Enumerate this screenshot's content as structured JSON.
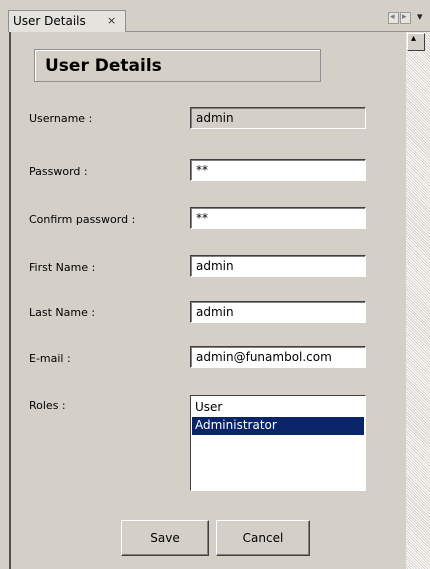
{
  "tab": {
    "title": "User Details",
    "close_glyph": "×"
  },
  "nav": {
    "prev_icon": "◂",
    "next_icon": "▸",
    "menu_icon": "▾"
  },
  "scrollbar": {
    "up_icon": "▴"
  },
  "form": {
    "title": "User Details",
    "fields": [
      {
        "label": "Username :",
        "value": "admin",
        "readonly": true
      },
      {
        "label": "Password :",
        "value": "**"
      },
      {
        "label": "Confirm password :",
        "value": "**"
      },
      {
        "label": "First Name :",
        "value": "admin"
      },
      {
        "label": "Last Name :",
        "value": "admin"
      },
      {
        "label": "E-mail :",
        "value": "admin@funambol.com"
      }
    ],
    "roles": {
      "label": "Roles :",
      "options": [
        "User",
        "Administrator"
      ],
      "selected": "Administrator"
    }
  },
  "buttons": {
    "save": "Save",
    "cancel": "Cancel"
  },
  "colors": {
    "background": "#d4d0c8",
    "selection": "#0a246a",
    "selection_text": "#ffffff"
  }
}
